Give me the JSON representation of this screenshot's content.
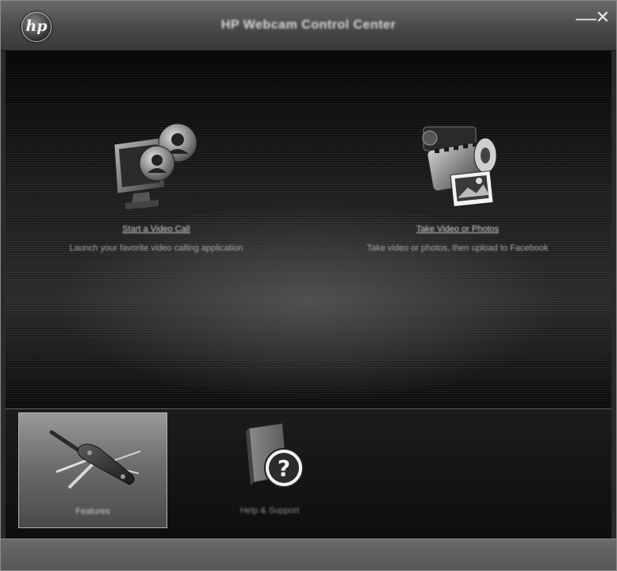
{
  "window": {
    "title": "HP Webcam Control Center",
    "logo_text": "hp",
    "minimize_glyph": "—",
    "close_glyph": "✕"
  },
  "features": [
    {
      "link": "Start a Video Call",
      "description": "Launch your favorite video calling application",
      "icon": "video-call-icon"
    },
    {
      "link": "Take Video or Photos",
      "description": "Take video or photos, then upload to Facebook",
      "icon": "camera-film-icon"
    }
  ],
  "nav": [
    {
      "label": "Features",
      "icon": "swiss-knife-icon",
      "active": true
    },
    {
      "label": "Help & Support",
      "icon": "help-book-icon",
      "active": false
    }
  ]
}
